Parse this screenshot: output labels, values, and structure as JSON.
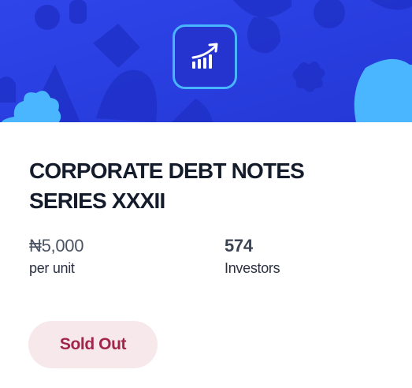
{
  "banner": {
    "icon": "growth-chart-icon",
    "colors": {
      "background": "#2a3fe0",
      "accent": "#47b5ff"
    }
  },
  "product": {
    "title_line1": "CORPORATE DEBT NOTES",
    "title_line2": "SERIES XXXII"
  },
  "stats": {
    "price": {
      "value": "₦5,000",
      "label": "per unit"
    },
    "investors": {
      "value": "574",
      "label": "Investors"
    }
  },
  "status": {
    "label": "Sold Out",
    "color": "#a1264a",
    "background": "#f7e8ec"
  }
}
